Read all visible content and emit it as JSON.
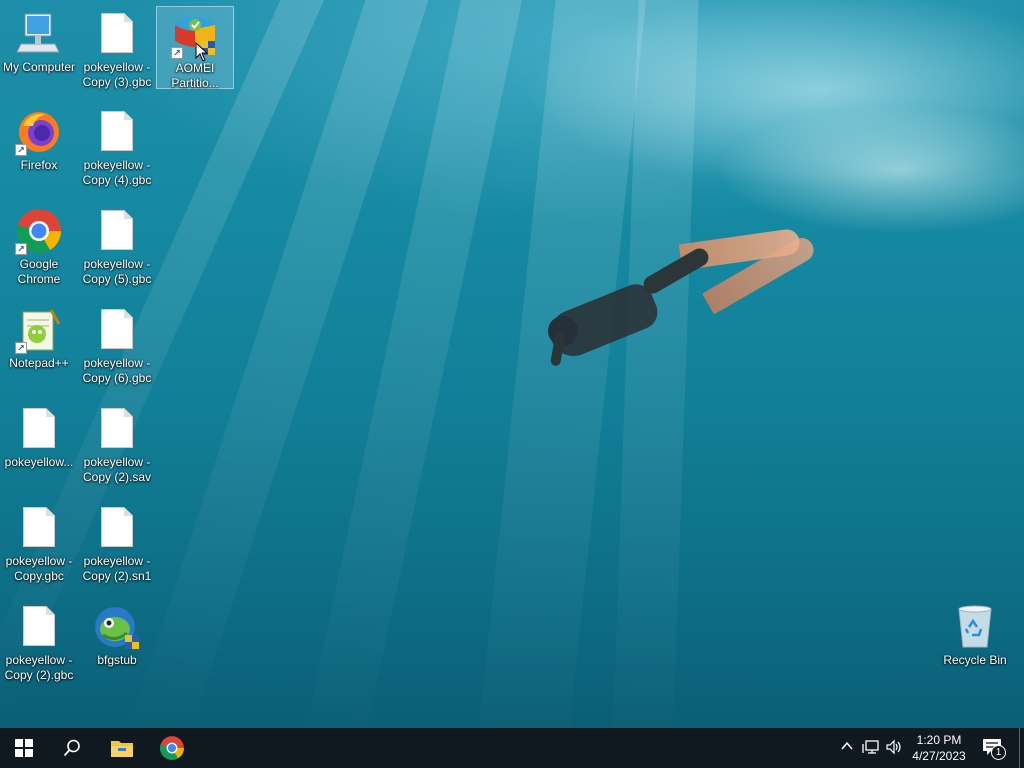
{
  "desktop": {
    "icons": [
      {
        "label": "My Computer",
        "icon": "computer-icon"
      },
      {
        "label": "pokeyellow - Copy (3).gbc",
        "icon": "file-icon"
      },
      {
        "label": "AOMEI Partitio...",
        "icon": "aomei-partition-icon",
        "selected": true
      },
      {
        "label": "Firefox",
        "icon": "firefox-icon"
      },
      {
        "label": "pokeyellow - Copy (4).gbc",
        "icon": "file-icon"
      },
      {
        "label": "Google Chrome",
        "icon": "chrome-icon"
      },
      {
        "label": "pokeyellow - Copy (5).gbc",
        "icon": "file-icon"
      },
      {
        "label": "Notepad++",
        "icon": "notepadpp-icon"
      },
      {
        "label": "pokeyellow - Copy (6).gbc",
        "icon": "file-icon"
      },
      {
        "label": "pokeyellow...",
        "icon": "file-icon"
      },
      {
        "label": "pokeyellow - Copy (2).sav",
        "icon": "file-icon"
      },
      {
        "label": "pokeyellow - Copy.gbc",
        "icon": "file-icon"
      },
      {
        "label": "pokeyellow - Copy (2).sn1",
        "icon": "file-icon"
      },
      {
        "label": "pokeyellow - Copy (2).gbc",
        "icon": "file-icon"
      },
      {
        "label": "bfgstub",
        "icon": "bfgstub-icon"
      },
      {
        "label": "Recycle Bin",
        "icon": "recycle-bin-icon"
      }
    ]
  },
  "taskbar": {
    "start": "start-icon",
    "search": "search-icon",
    "pinned": [
      "file-explorer-icon",
      "chrome-icon"
    ],
    "tray": {
      "icons": [
        "chevron-up-icon",
        "network-icon",
        "volume-icon"
      ],
      "time": "1:20 PM",
      "date": "4/27/2023",
      "notification_count": "1"
    }
  },
  "colors": {
    "taskbar_bg": "#101820",
    "water_top": "#1d8ea9",
    "water_bottom": "#0a5f76",
    "selection": "#a0d2e6"
  }
}
